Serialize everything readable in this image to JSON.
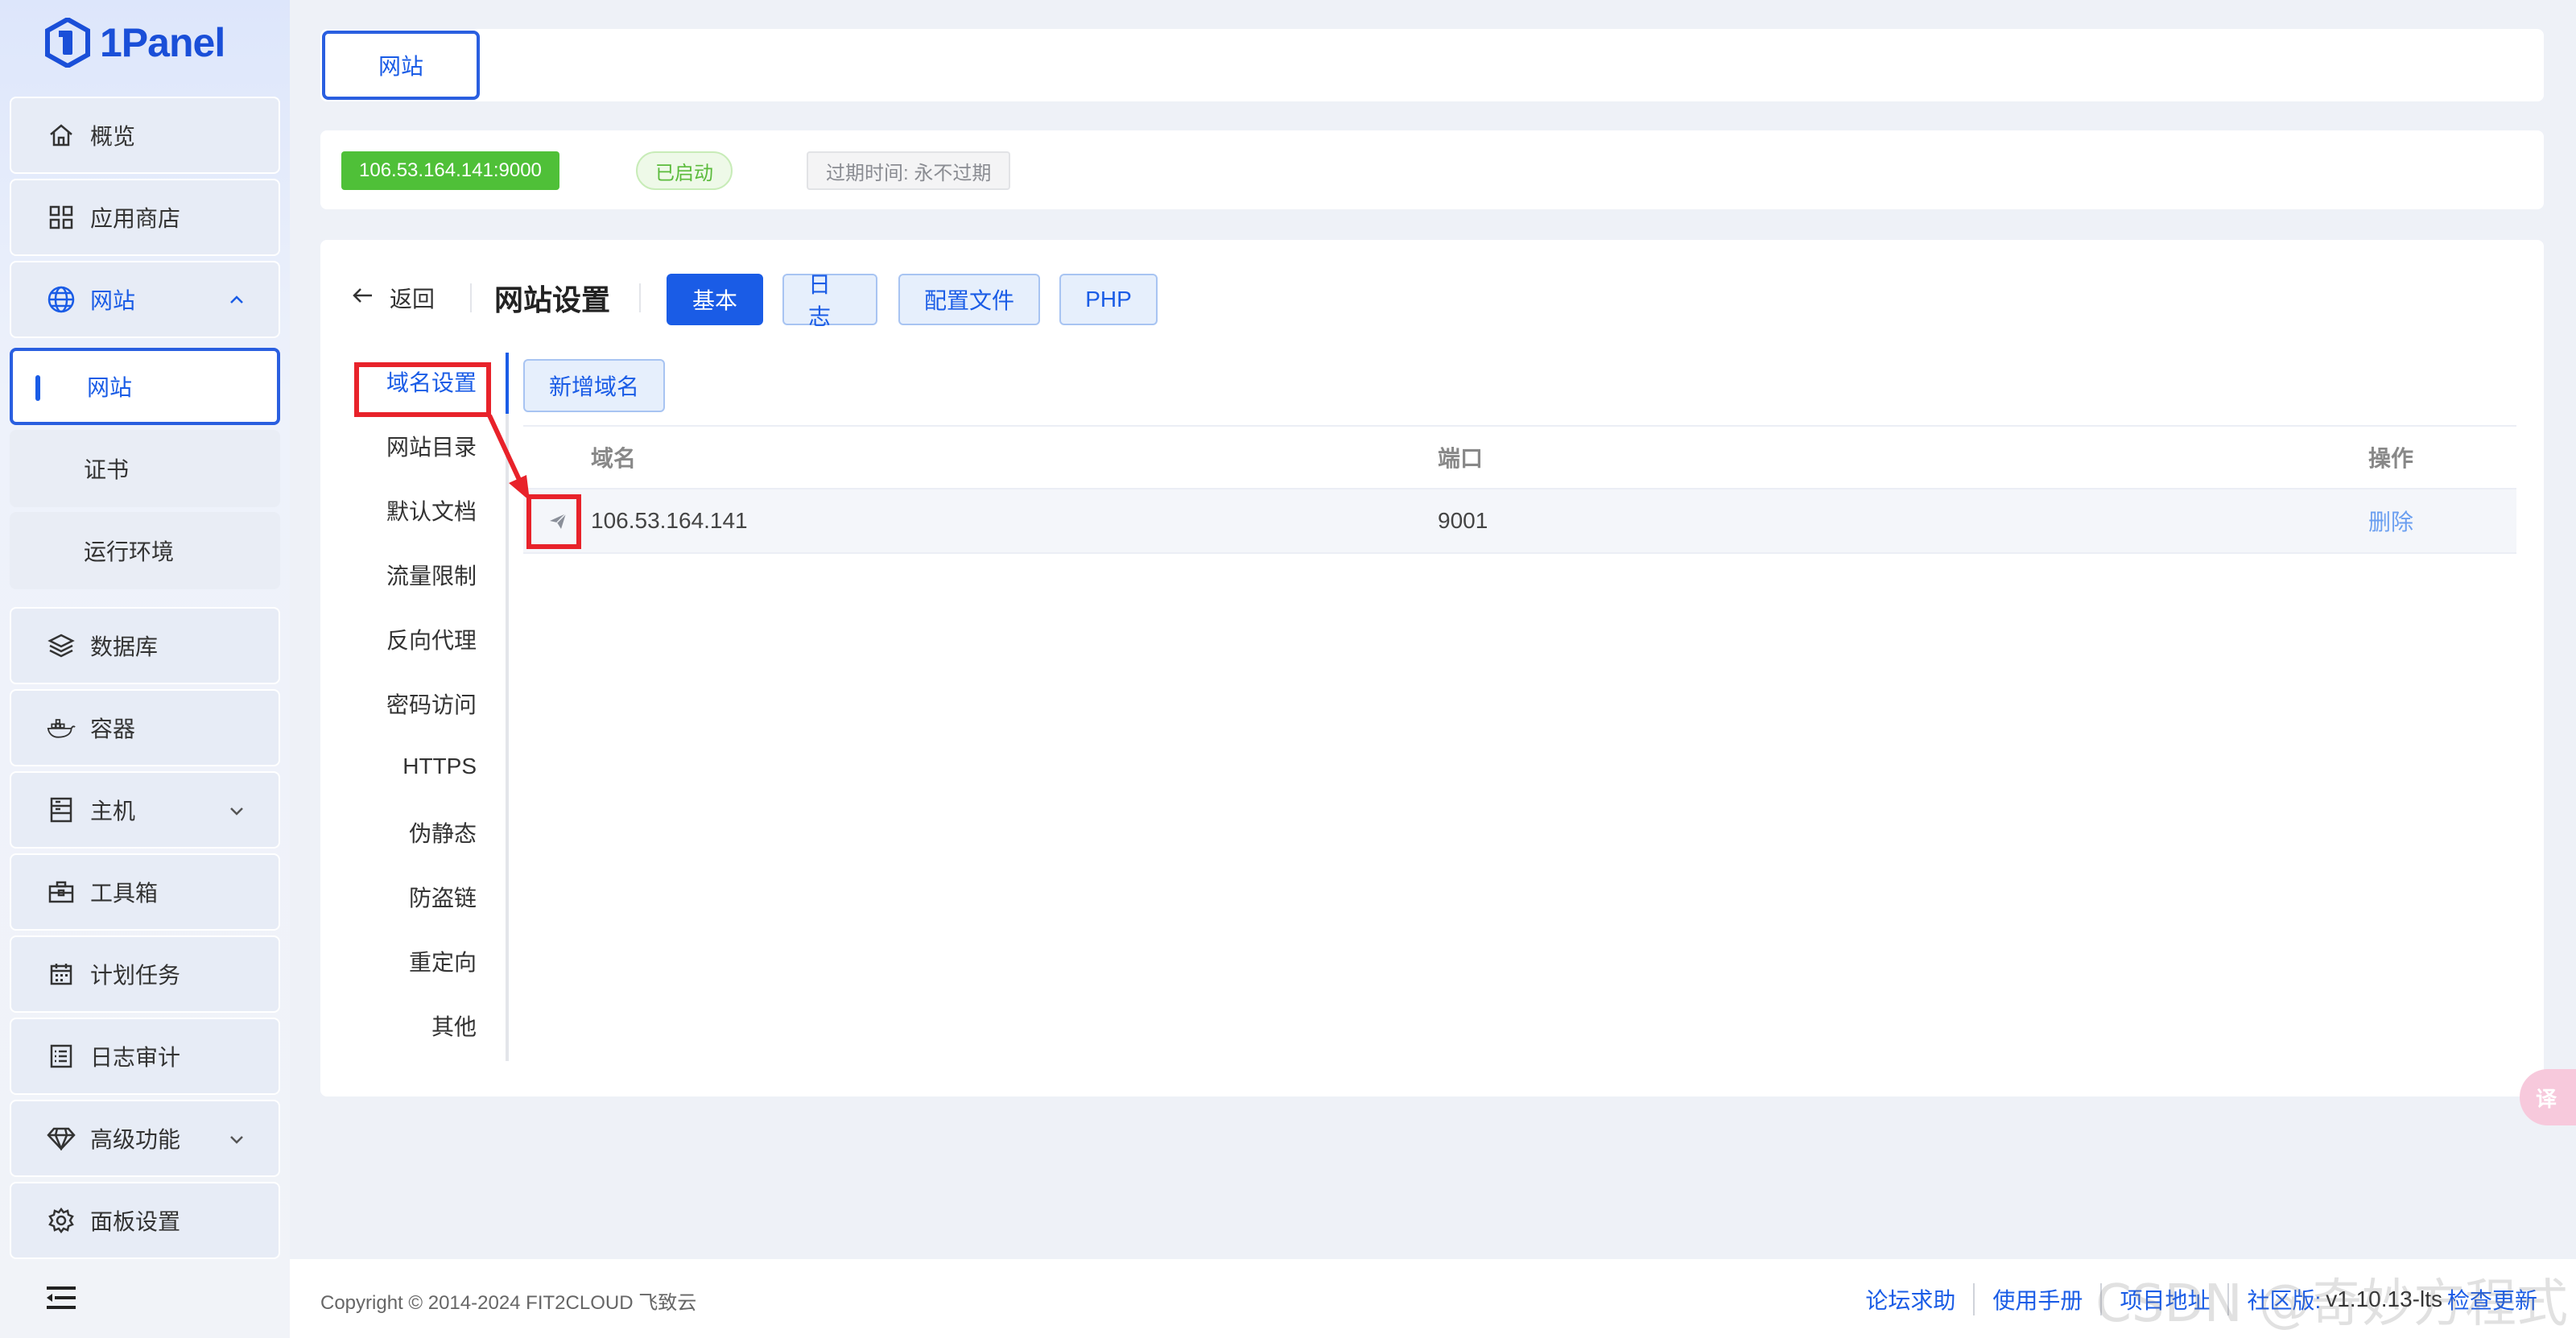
{
  "app": {
    "logo_text": "1Panel"
  },
  "sidebar": {
    "items": [
      {
        "label": "概览",
        "icon": "home-icon"
      },
      {
        "label": "应用商店",
        "icon": "grid-icon"
      },
      {
        "label": "网站",
        "icon": "globe-icon",
        "expanded": true,
        "children": [
          {
            "label": "网站",
            "active": true
          },
          {
            "label": "证书"
          },
          {
            "label": "运行环境"
          }
        ]
      },
      {
        "label": "数据库",
        "icon": "layers-icon"
      },
      {
        "label": "容器",
        "icon": "docker-icon"
      },
      {
        "label": "主机",
        "icon": "server-icon",
        "has_children": true
      },
      {
        "label": "工具箱",
        "icon": "toolbox-icon"
      },
      {
        "label": "计划任务",
        "icon": "calendar-icon"
      },
      {
        "label": "日志审计",
        "icon": "log-icon"
      },
      {
        "label": "高级功能",
        "icon": "diamond-icon",
        "has_children": true
      },
      {
        "label": "面板设置",
        "icon": "gear-icon"
      }
    ]
  },
  "top_tabs": {
    "website": "网站"
  },
  "info": {
    "address": "106.53.164.141:9000",
    "status": "已启动",
    "expire": "过期时间: 永不过期"
  },
  "header": {
    "back_label": "返回",
    "title": "网站设置",
    "tabs": [
      "基本",
      "日志",
      "配置文件",
      "PHP"
    ],
    "active_tab": "基本"
  },
  "settings_menu": {
    "items": [
      "域名设置",
      "网站目录",
      "默认文档",
      "流量限制",
      "反向代理",
      "密码访问",
      "HTTPS",
      "伪静态",
      "防盗链",
      "重定向",
      "其他"
    ],
    "active": "域名设置"
  },
  "domain_panel": {
    "add_button": "新增域名",
    "columns": [
      "域名",
      "端口",
      "操作"
    ],
    "rows": [
      {
        "domain": "106.53.164.141",
        "port": "9001",
        "action": "删除"
      }
    ]
  },
  "footer": {
    "copyright": "Copyright © 2014-2024 FIT2CLOUD 飞致云",
    "links": [
      "论坛求助",
      "使用手册",
      "项目地址",
      "社区版:"
    ],
    "version": "v1.10.13-lts",
    "check_update": "检查更新"
  },
  "translate_fab": "译",
  "watermark": "CSDN @奇妙方程式",
  "colors": {
    "accent": "#1a5ce6",
    "running": "#4fc038",
    "highlight": "#e8222a"
  }
}
